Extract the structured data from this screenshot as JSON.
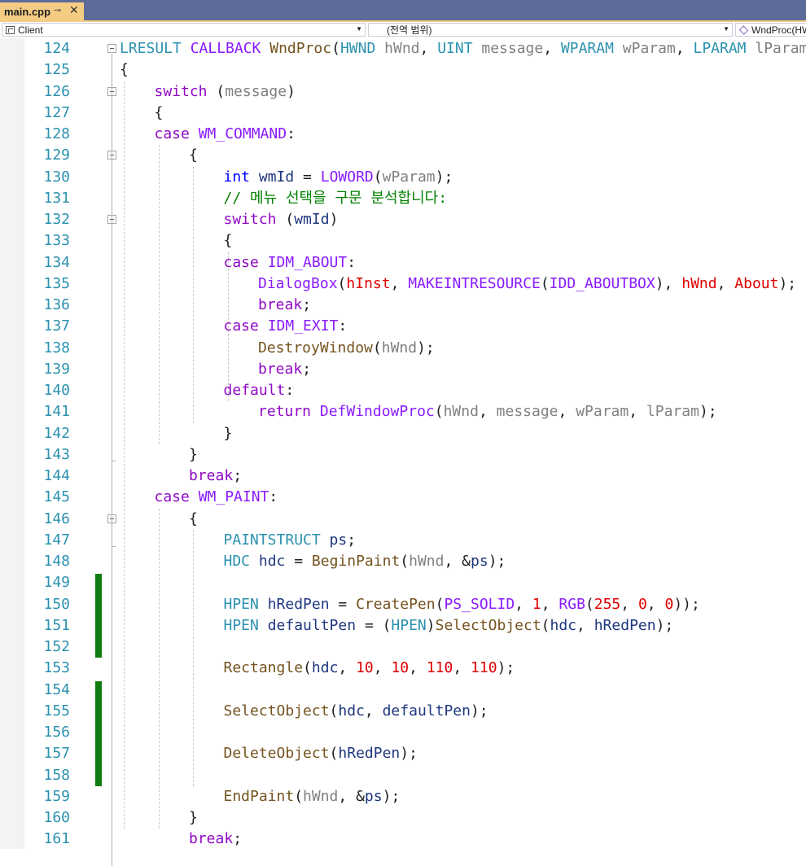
{
  "tab": {
    "file_name": "main.cpp",
    "pin_icon": "pin-icon",
    "close_icon": "close-icon"
  },
  "navbar": {
    "project": "Client",
    "scope": "(전역 범위)",
    "member": "WndProc(HW"
  },
  "colors": {
    "tab_bar": "#5d6b99",
    "active_tab": "#f5cc84",
    "line_number": "#2b91af",
    "change_bar": "#107c10",
    "keyword": "#8f08c4",
    "type": "#2b91af",
    "macro": "#8a1bff",
    "function": "#74531f",
    "parameter": "#808080",
    "local": "#1f377f",
    "number": "#e00000",
    "comment": "#008000"
  },
  "editor": {
    "lines": [
      {
        "n": "124",
        "indent": 0,
        "fold": "open",
        "tokens": [
          [
            "LRESULT ",
            "type"
          ],
          [
            "CALLBACK ",
            "macro"
          ],
          [
            "WndProc",
            "fn"
          ],
          [
            "(",
            "plain"
          ],
          [
            "HWND ",
            "type"
          ],
          [
            "hWnd",
            "param"
          ],
          [
            ", ",
            "plain"
          ],
          [
            "UINT ",
            "type"
          ],
          [
            "message",
            "param"
          ],
          [
            ", ",
            "plain"
          ],
          [
            "WPARAM ",
            "type"
          ],
          [
            "wParam",
            "param"
          ],
          [
            ", ",
            "plain"
          ],
          [
            "LPARAM ",
            "type"
          ],
          [
            "lParam",
            "param"
          ],
          [
            ")",
            "plain"
          ]
        ]
      },
      {
        "n": "125",
        "indent": 0,
        "tokens": [
          [
            "{",
            "plain"
          ]
        ]
      },
      {
        "n": "126",
        "indent": 1,
        "fold": "open",
        "tokens": [
          [
            "switch ",
            "kw"
          ],
          [
            "(",
            "plain"
          ],
          [
            "message",
            "param"
          ],
          [
            ")",
            "plain"
          ]
        ]
      },
      {
        "n": "127",
        "indent": 1,
        "tokens": [
          [
            "{",
            "plain"
          ]
        ]
      },
      {
        "n": "128",
        "indent": 1,
        "tokens": [
          [
            "case ",
            "kw"
          ],
          [
            "WM_COMMAND",
            "macro"
          ],
          [
            ":",
            "plain"
          ]
        ]
      },
      {
        "n": "129",
        "indent": 2,
        "fold": "open",
        "tokens": [
          [
            "{",
            "plain"
          ]
        ]
      },
      {
        "n": "130",
        "indent": 3,
        "tokens": [
          [
            "int ",
            "int"
          ],
          [
            "wmId ",
            "local"
          ],
          [
            "= ",
            "plain"
          ],
          [
            "LOWORD",
            "macro"
          ],
          [
            "(",
            "plain"
          ],
          [
            "wParam",
            "param"
          ],
          [
            ");",
            "plain"
          ]
        ]
      },
      {
        "n": "131",
        "indent": 3,
        "tokens": [
          [
            "// 메뉴 선택을 구문 분석합니다:",
            "comment"
          ]
        ]
      },
      {
        "n": "132",
        "indent": 3,
        "fold": "open",
        "tokens": [
          [
            "switch ",
            "kw"
          ],
          [
            "(",
            "plain"
          ],
          [
            "wmId",
            "local"
          ],
          [
            ")",
            "plain"
          ]
        ]
      },
      {
        "n": "133",
        "indent": 3,
        "tokens": [
          [
            "{",
            "plain"
          ]
        ]
      },
      {
        "n": "134",
        "indent": 3,
        "tokens": [
          [
            "case ",
            "kw"
          ],
          [
            "IDM_ABOUT",
            "macro"
          ],
          [
            ":",
            "plain"
          ]
        ]
      },
      {
        "n": "135",
        "indent": 4,
        "tokens": [
          [
            "DialogBox",
            "macro"
          ],
          [
            "(",
            "plain"
          ],
          [
            "hInst",
            "global"
          ],
          [
            ", ",
            "plain"
          ],
          [
            "MAKEINTRESOURCE",
            "macro"
          ],
          [
            "(",
            "plain"
          ],
          [
            "IDD_ABOUTBOX",
            "macro"
          ],
          [
            "), ",
            "plain"
          ],
          [
            "hWnd",
            "global"
          ],
          [
            ", ",
            "plain"
          ],
          [
            "About",
            "global"
          ],
          [
            ");",
            "plain"
          ]
        ]
      },
      {
        "n": "136",
        "indent": 4,
        "tokens": [
          [
            "break",
            "kw"
          ],
          [
            ";",
            "plain"
          ]
        ]
      },
      {
        "n": "137",
        "indent": 3,
        "tokens": [
          [
            "case ",
            "kw"
          ],
          [
            "IDM_EXIT",
            "macro"
          ],
          [
            ":",
            "plain"
          ]
        ]
      },
      {
        "n": "138",
        "indent": 4,
        "tokens": [
          [
            "DestroyWindow",
            "fn"
          ],
          [
            "(",
            "plain"
          ],
          [
            "hWnd",
            "param"
          ],
          [
            ");",
            "plain"
          ]
        ]
      },
      {
        "n": "139",
        "indent": 4,
        "tokens": [
          [
            "break",
            "kw"
          ],
          [
            ";",
            "plain"
          ]
        ]
      },
      {
        "n": "140",
        "indent": 3,
        "tokens": [
          [
            "default",
            "kw"
          ],
          [
            ":",
            "plain"
          ]
        ]
      },
      {
        "n": "141",
        "indent": 4,
        "tokens": [
          [
            "return ",
            "kw"
          ],
          [
            "DefWindowProc",
            "macro"
          ],
          [
            "(",
            "plain"
          ],
          [
            "hWnd",
            "param"
          ],
          [
            ", ",
            "plain"
          ],
          [
            "message",
            "param"
          ],
          [
            ", ",
            "plain"
          ],
          [
            "wParam",
            "param"
          ],
          [
            ", ",
            "plain"
          ],
          [
            "lParam",
            "param"
          ],
          [
            ");",
            "plain"
          ]
        ]
      },
      {
        "n": "142",
        "indent": 3,
        "tokens": [
          [
            "}",
            "plain"
          ]
        ]
      },
      {
        "n": "143",
        "indent": 2,
        "tokens": [
          [
            "}",
            "plain"
          ]
        ]
      },
      {
        "n": "144",
        "indent": 2,
        "tokens": [
          [
            "break",
            "kw"
          ],
          [
            ";",
            "plain"
          ]
        ]
      },
      {
        "n": "145",
        "indent": 1,
        "tokens": [
          [
            "case ",
            "kw"
          ],
          [
            "WM_PAINT",
            "macro"
          ],
          [
            ":",
            "plain"
          ]
        ]
      },
      {
        "n": "146",
        "indent": 2,
        "fold": "open",
        "tokens": [
          [
            "{",
            "plain"
          ]
        ]
      },
      {
        "n": "147",
        "indent": 3,
        "tokens": [
          [
            "PAINTSTRUCT ",
            "type"
          ],
          [
            "ps",
            "local"
          ],
          [
            ";",
            "plain"
          ]
        ]
      },
      {
        "n": "148",
        "indent": 3,
        "tokens": [
          [
            "HDC ",
            "type"
          ],
          [
            "hdc ",
            "local"
          ],
          [
            "= ",
            "plain"
          ],
          [
            "BeginPaint",
            "fn"
          ],
          [
            "(",
            "plain"
          ],
          [
            "hWnd",
            "param"
          ],
          [
            ", &",
            "plain"
          ],
          [
            "ps",
            "local"
          ],
          [
            ");",
            "plain"
          ]
        ]
      },
      {
        "n": "149",
        "indent": 3,
        "changed": true,
        "tokens": []
      },
      {
        "n": "150",
        "indent": 3,
        "changed": true,
        "tokens": [
          [
            "HPEN ",
            "type"
          ],
          [
            "hRedPen ",
            "local"
          ],
          [
            "= ",
            "plain"
          ],
          [
            "CreatePen",
            "fn"
          ],
          [
            "(",
            "plain"
          ],
          [
            "PS_SOLID",
            "macro"
          ],
          [
            ", ",
            "plain"
          ],
          [
            "1",
            "num"
          ],
          [
            ", ",
            "plain"
          ],
          [
            "RGB",
            "macro"
          ],
          [
            "(",
            "plain"
          ],
          [
            "255",
            "num"
          ],
          [
            ", ",
            "plain"
          ],
          [
            "0",
            "num"
          ],
          [
            ", ",
            "plain"
          ],
          [
            "0",
            "num"
          ],
          [
            "));",
            "plain"
          ]
        ]
      },
      {
        "n": "151",
        "indent": 3,
        "changed": true,
        "tokens": [
          [
            "HPEN ",
            "type"
          ],
          [
            "defaultPen ",
            "local"
          ],
          [
            "= (",
            "plain"
          ],
          [
            "HPEN",
            "type"
          ],
          [
            ")",
            "plain"
          ],
          [
            "SelectObject",
            "fn"
          ],
          [
            "(",
            "plain"
          ],
          [
            "hdc",
            "local"
          ],
          [
            ", ",
            "plain"
          ],
          [
            "hRedPen",
            "local"
          ],
          [
            ");",
            "plain"
          ]
        ]
      },
      {
        "n": "152",
        "indent": 3,
        "changed": true,
        "tokens": []
      },
      {
        "n": "153",
        "indent": 3,
        "tokens": [
          [
            "Rectangle",
            "fn"
          ],
          [
            "(",
            "plain"
          ],
          [
            "hdc",
            "local"
          ],
          [
            ", ",
            "plain"
          ],
          [
            "10",
            "num"
          ],
          [
            ", ",
            "plain"
          ],
          [
            "10",
            "num"
          ],
          [
            ", ",
            "plain"
          ],
          [
            "110",
            "num"
          ],
          [
            ", ",
            "plain"
          ],
          [
            "110",
            "num"
          ],
          [
            ");",
            "plain"
          ]
        ]
      },
      {
        "n": "154",
        "indent": 3,
        "changed": true,
        "tokens": []
      },
      {
        "n": "155",
        "indent": 3,
        "changed": true,
        "tokens": [
          [
            "SelectObject",
            "fn"
          ],
          [
            "(",
            "plain"
          ],
          [
            "hdc",
            "local"
          ],
          [
            ", ",
            "plain"
          ],
          [
            "defaultPen",
            "local"
          ],
          [
            ");",
            "plain"
          ]
        ]
      },
      {
        "n": "156",
        "indent": 3,
        "changed": true,
        "tokens": []
      },
      {
        "n": "157",
        "indent": 3,
        "changed": true,
        "tokens": [
          [
            "DeleteObject",
            "fn"
          ],
          [
            "(",
            "plain"
          ],
          [
            "hRedPen",
            "local"
          ],
          [
            ");",
            "plain"
          ]
        ]
      },
      {
        "n": "158",
        "indent": 3,
        "changed": true,
        "tokens": []
      },
      {
        "n": "159",
        "indent": 3,
        "tokens": [
          [
            "EndPaint",
            "fn"
          ],
          [
            "(",
            "plain"
          ],
          [
            "hWnd",
            "param"
          ],
          [
            ", &",
            "plain"
          ],
          [
            "ps",
            "local"
          ],
          [
            ");",
            "plain"
          ]
        ]
      },
      {
        "n": "160",
        "indent": 2,
        "tokens": [
          [
            "}",
            "plain"
          ]
        ]
      },
      {
        "n": "161",
        "indent": 2,
        "tokens": [
          [
            "break",
            "kw"
          ],
          [
            ";",
            "plain"
          ]
        ]
      }
    ]
  }
}
